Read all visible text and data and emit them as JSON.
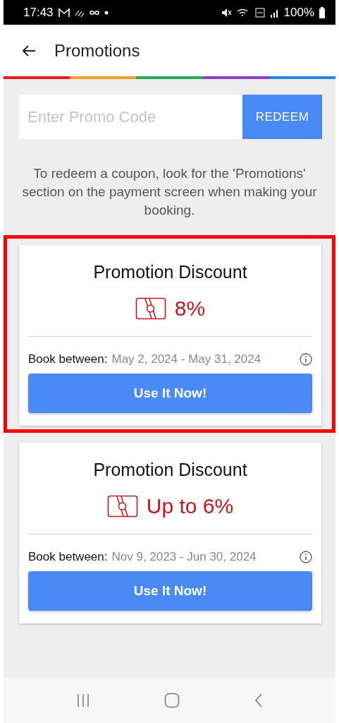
{
  "status_bar": {
    "time": "17:43",
    "battery": "100%"
  },
  "header": {
    "title": "Promotions"
  },
  "promo_entry": {
    "placeholder": "Enter Promo Code",
    "button": "REDEEM"
  },
  "hint": "To redeem a coupon, look for the 'Promotions' section on the payment screen when making your booking.",
  "promotions": [
    {
      "title": "Promotion Discount",
      "discount": "8%",
      "period_label": "Book between:",
      "period": "May 2, 2024 - May 31, 2024",
      "button": "Use It Now!",
      "highlighted": true
    },
    {
      "title": "Promotion Discount",
      "discount": "Up to 6%",
      "period_label": "Book between:",
      "period": "Nov 9, 2023 - Jun 30, 2024",
      "button": "Use It Now!",
      "highlighted": false
    }
  ]
}
